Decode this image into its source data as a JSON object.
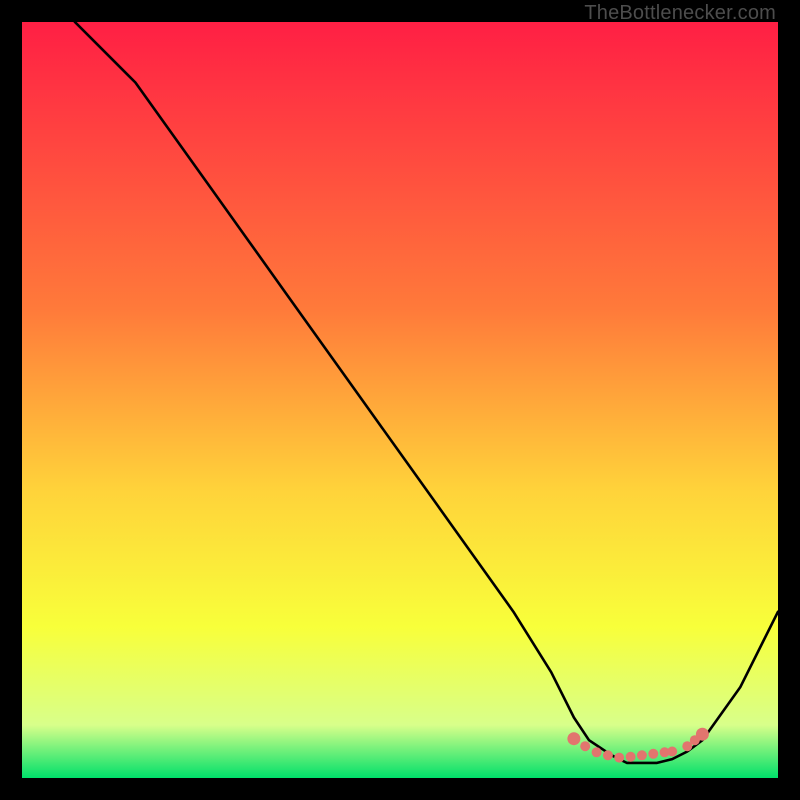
{
  "watermark": "TheBottlenecker.com",
  "colors": {
    "black": "#000000",
    "curve": "#000000",
    "marker": "#e2756e",
    "grad_top": "#ff1f44",
    "grad_mid1": "#ff7a3a",
    "grad_mid2": "#ffd33a",
    "grad_mid3": "#f8ff3a",
    "grad_bottom1": "#d8ff8a",
    "grad_bottom2": "#00e06a"
  },
  "chart_data": {
    "type": "line",
    "title": "",
    "xlabel": "",
    "ylabel": "",
    "xlim": [
      0,
      100
    ],
    "ylim": [
      0,
      100
    ],
    "series": [
      {
        "name": "bottleneck-curve",
        "x": [
          7,
          10,
          15,
          20,
          25,
          30,
          35,
          40,
          45,
          50,
          55,
          60,
          65,
          70,
          73,
          75,
          78,
          80,
          82,
          84,
          86,
          88,
          90,
          95,
          100
        ],
        "y": [
          100,
          97,
          92,
          85,
          78,
          71,
          64,
          57,
          50,
          43,
          36,
          29,
          22,
          14,
          8,
          5,
          3,
          2,
          2,
          2,
          2.5,
          3.5,
          5,
          12,
          22
        ]
      }
    ],
    "markers": {
      "name": "highlight-band",
      "x": [
        73,
        74.5,
        76,
        77.5,
        79,
        80.5,
        82,
        83.5,
        85,
        86,
        88,
        89,
        90
      ],
      "y": [
        5.2,
        4.2,
        3.4,
        3.0,
        2.7,
        2.8,
        3.0,
        3.2,
        3.4,
        3.5,
        4.2,
        5.0,
        5.8
      ]
    }
  }
}
